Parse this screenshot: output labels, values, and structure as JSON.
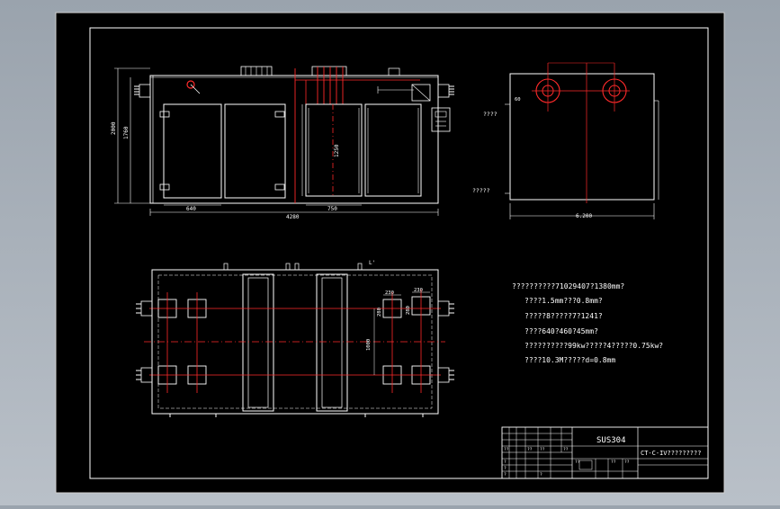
{
  "drawing": {
    "front_view": {
      "dim_inner_width": "640",
      "dim_bay_width": "750",
      "dim_total_length": "4280",
      "dim_total_height": "2000",
      "dim_door_height": "1760",
      "dim_chamber_height": "1250"
    },
    "side_view": {
      "dim_width": "6.200",
      "dim_offset": "60",
      "label_top": "????",
      "label_bottom": "?????"
    },
    "top_view": {
      "dim_duct_a": "230",
      "dim_duct_b": "230",
      "dim_duct_c": "280",
      "dim_duct_d": "280",
      "dim_spacing": "1000",
      "marker": "L'"
    },
    "notes": [
      "??????????71029407?1380mm?",
      "????1.5mm???0.8mm?",
      "?????8?????7?1241?",
      "????640?460?45mm?",
      "??????????99kw?????4?????0.75kw?",
      "????10.3M?????d=0.8mm"
    ],
    "title_block": {
      "material": "SUS304",
      "drawing_name": "CT-C-IV?????????",
      "col_labels": [
        "??",
        "??",
        "??"
      ],
      "sub_labels": [
        "??",
        "??",
        "??",
        "??"
      ],
      "small_codes": [
        "?",
        "?",
        "?",
        "?"
      ]
    }
  }
}
